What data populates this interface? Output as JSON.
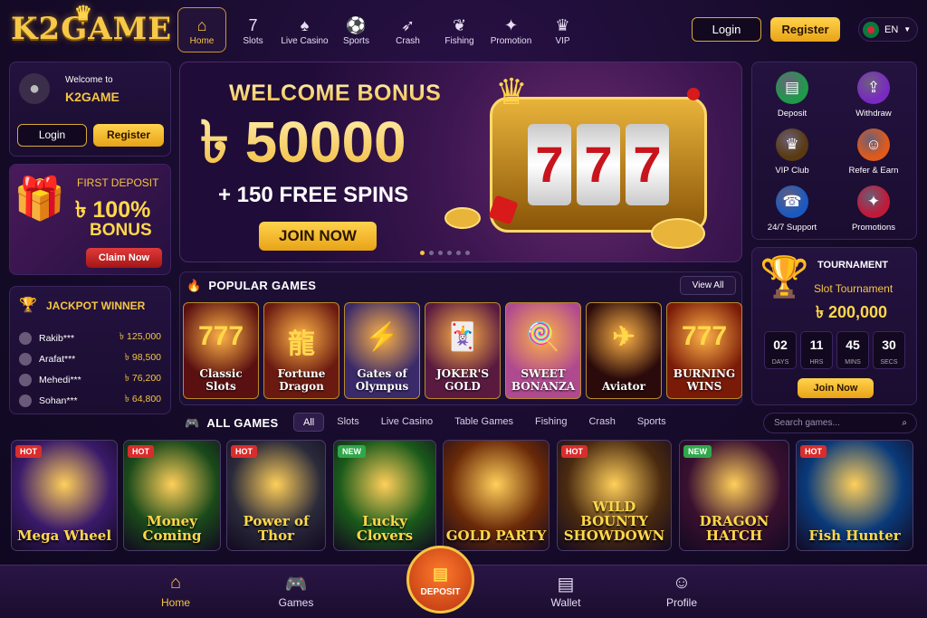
{
  "brand": {
    "logo_text": "K2GAME"
  },
  "nav": [
    {
      "label": "Home",
      "icon": "home-icon",
      "glyph": "⌂"
    },
    {
      "label": "Slots",
      "icon": "slot-machine-icon",
      "glyph": "7"
    },
    {
      "label": "Live Casino",
      "icon": "dealer-icon",
      "glyph": "♠"
    },
    {
      "label": "Sports",
      "icon": "soccer-ball-icon",
      "glyph": "⚽"
    },
    {
      "label": "Crash",
      "icon": "rocket-icon",
      "glyph": "➶"
    },
    {
      "label": "Fishing",
      "icon": "fish-icon",
      "glyph": "❦"
    },
    {
      "label": "Promotion",
      "icon": "gift-icon",
      "glyph": "✦"
    },
    {
      "label": "VIP",
      "icon": "crown-icon",
      "glyph": "♛"
    }
  ],
  "header": {
    "login_label": "Login",
    "register_label": "Register",
    "language": "EN"
  },
  "welcome": {
    "line1": "Welcome to",
    "line2": "K2GAME",
    "login_label": "Login",
    "register_label": "Register"
  },
  "first_deposit": {
    "title": "FIRST DEPOSIT",
    "percent": "৳ 100%",
    "bonus": "BONUS",
    "cta": "Claim Now"
  },
  "jackpot": {
    "title": "JACKPOT WINNER",
    "winners": [
      {
        "name": "Rakib***",
        "amount": "৳ 125,000"
      },
      {
        "name": "Arafat***",
        "amount": "৳ 98,500"
      },
      {
        "name": "Mehedi***",
        "amount": "৳ 76,200"
      },
      {
        "name": "Sohan***",
        "amount": "৳ 64,800"
      }
    ]
  },
  "banner": {
    "headline": "WELCOME BONUS",
    "amount": "৳ 50000",
    "spins": "+ 150 FREE SPINS",
    "cta": "JOIN NOW",
    "slides": 6,
    "active_slide": 1,
    "reel_symbol": "7"
  },
  "popular": {
    "title": "POPULAR GAMES",
    "view_all": "View All",
    "games": [
      {
        "label": "Classic Slots",
        "art": "777",
        "bg": "#5a1010"
      },
      {
        "label": "Fortune Dragon",
        "art": "龍",
        "bg": "#6a1a10"
      },
      {
        "label": "Gates of Olympus",
        "art": "⚡",
        "bg": "#3a2a6a"
      },
      {
        "label": "JOKER'S GOLD",
        "art": "🃏",
        "bg": "#5a1a40"
      },
      {
        "label": "SWEET BONANZA",
        "art": "🍭",
        "bg": "#b04a90"
      },
      {
        "label": "Aviator",
        "art": "✈",
        "bg": "#2a0a0a"
      },
      {
        "label": "BURNING WINS",
        "art": "777",
        "bg": "#7a1a08"
      }
    ]
  },
  "all_games": {
    "title": "ALL GAMES",
    "filters": [
      "All",
      "Slots",
      "Live Casino",
      "Table Games",
      "Fishing",
      "Crash",
      "Sports"
    ],
    "active_filter": "All",
    "search_placeholder": "Search games...",
    "games": [
      {
        "label": "Mega Wheel",
        "tag": "HOT",
        "bg": "#3a1a6a"
      },
      {
        "label": "Money Coming",
        "tag": "HOT",
        "bg": "#1a4a1a"
      },
      {
        "label": "Power of Thor",
        "tag": "HOT",
        "bg": "#2a2a3a"
      },
      {
        "label": "Lucky Clovers",
        "tag": "NEW",
        "bg": "#1a5a1a"
      },
      {
        "label": "GOLD PARTY",
        "tag": "",
        "bg": "#6a2a08"
      },
      {
        "label": "WILD BOUNTY SHOWDOWN",
        "tag": "HOT",
        "bg": "#4a2a10"
      },
      {
        "label": "DRAGON HATCH",
        "tag": "NEW",
        "bg": "#3a1030"
      },
      {
        "label": "Fish Hunter",
        "tag": "HOT",
        "bg": "#0a3a7a"
      }
    ]
  },
  "quick_actions": [
    {
      "label": "Deposit",
      "icon": "wallet-icon",
      "glyph": "▤",
      "color": "#1f9a4a"
    },
    {
      "label": "Withdraw",
      "icon": "withdraw-icon",
      "glyph": "⇪",
      "color": "#7a2ac0"
    },
    {
      "label": "VIP Club",
      "icon": "crown-icon",
      "glyph": "♛",
      "color": "#5a3a10"
    },
    {
      "label": "Refer & Earn",
      "icon": "users-icon",
      "glyph": "☺",
      "color": "#e05a1a"
    },
    {
      "label": "24/7 Support",
      "icon": "headset-icon",
      "glyph": "☎",
      "color": "#1a5ac0"
    },
    {
      "label": "Promotions",
      "icon": "gift-icon",
      "glyph": "✦",
      "color": "#c01a3a"
    }
  ],
  "tournament": {
    "title": "TOURNAMENT",
    "name": "Slot Tournament",
    "prize": "৳ 200,000",
    "countdown": [
      {
        "value": "02",
        "unit": "DAYS"
      },
      {
        "value": "11",
        "unit": "HRS"
      },
      {
        "value": "45",
        "unit": "MINS"
      },
      {
        "value": "30",
        "unit": "SECS"
      }
    ],
    "cta": "Join Now"
  },
  "bottom_nav": {
    "home": "Home",
    "games": "Games",
    "deposit": "DEPOSIT",
    "wallet": "Wallet",
    "profile": "Profile"
  }
}
